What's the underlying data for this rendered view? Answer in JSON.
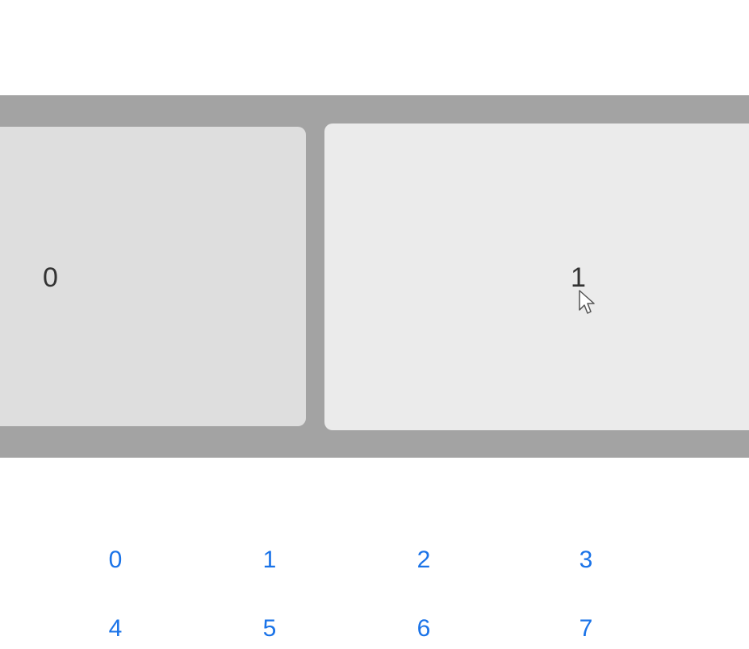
{
  "carousel": {
    "slides": [
      {
        "label": "0"
      },
      {
        "label": "1"
      }
    ]
  },
  "pager": {
    "items": [
      "0",
      "1",
      "2",
      "3",
      "4",
      "5",
      "6",
      "7"
    ]
  },
  "colors": {
    "carousel_bg": "#a3a3a3",
    "slide_active": "#ebebeb",
    "slide_inactive": "#dedede",
    "link": "#1a73e8"
  }
}
